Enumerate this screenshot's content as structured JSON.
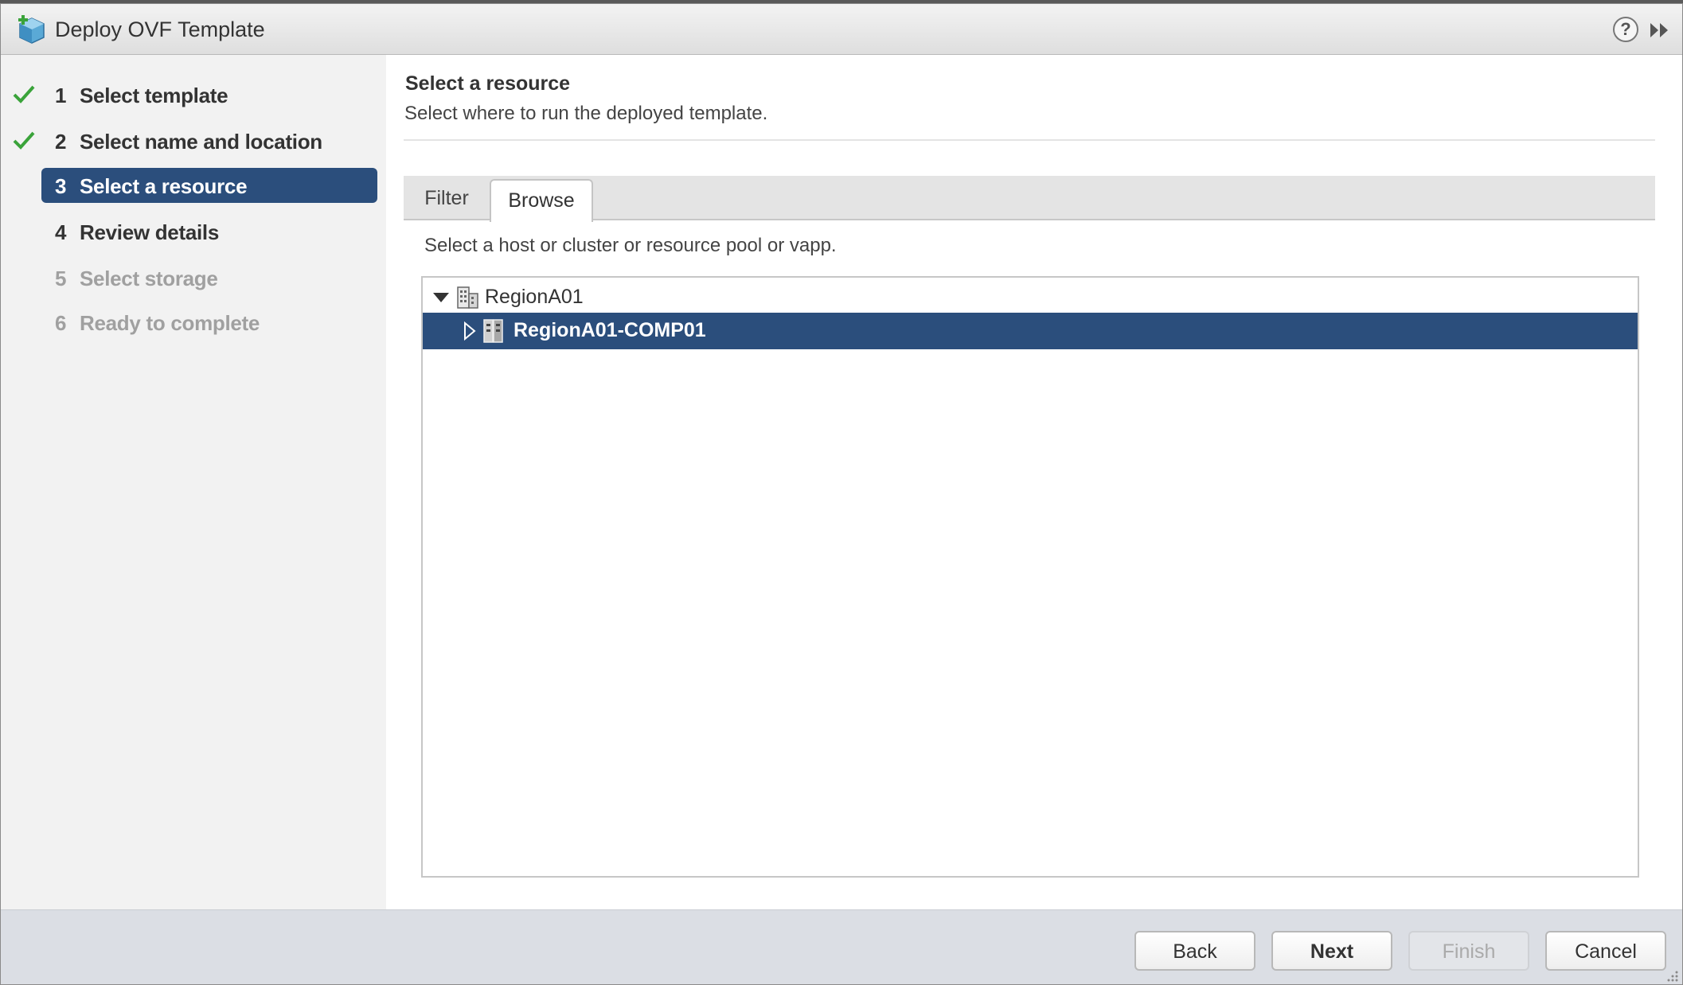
{
  "window": {
    "title": "Deploy OVF Template",
    "help_glyph": "?"
  },
  "nav": {
    "steps": [
      {
        "num": "1",
        "label": "Select template",
        "state": "completed"
      },
      {
        "num": "2",
        "label": "Select name and location",
        "state": "completed"
      },
      {
        "num": "3",
        "label": "Select a resource",
        "state": "active"
      },
      {
        "num": "4",
        "label": "Review details",
        "state": "enabled"
      },
      {
        "num": "5",
        "label": "Select storage",
        "state": "disabled"
      },
      {
        "num": "6",
        "label": "Ready to complete",
        "state": "disabled"
      }
    ]
  },
  "main": {
    "title": "Select a resource",
    "subtitle": "Select where to run the deployed template.",
    "tabs": [
      "Filter",
      "Browse"
    ],
    "active_tab": "Browse",
    "tree_hint": "Select a host or cluster or resource pool or vapp.",
    "tree": {
      "root_label": "RegionA01",
      "root_icon": "datacenter-icon",
      "child_label": "RegionA01-COMP01",
      "child_icon": "cluster-icon"
    }
  },
  "footer": {
    "back": "Back",
    "next": "Next",
    "finish": "Finish",
    "cancel": "Cancel"
  },
  "colors": {
    "accent": "#2b4e7c",
    "check_green": "#3aa33a",
    "disabled_text": "#a0a0a0"
  }
}
